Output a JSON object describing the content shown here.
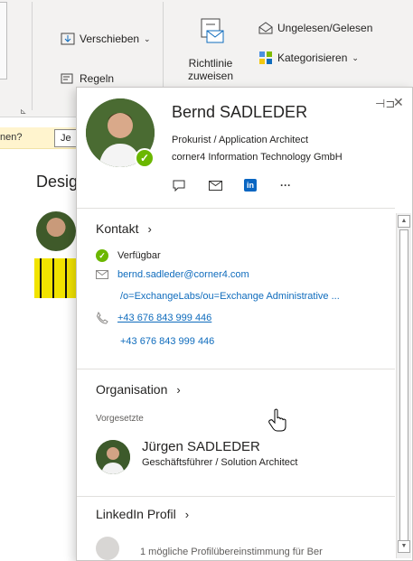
{
  "ribbon": {
    "move_label": "Verschieben",
    "rules_label": "Regeln",
    "policy_label": "Richtlinie",
    "policy_label_line2": "zuweisen",
    "unread_label": "Ungelesen/Gelesen",
    "categorize_label": "Kategorisieren"
  },
  "infobar": {
    "text": "nen?",
    "button_label": "Je"
  },
  "background": {
    "subject": "Desig"
  },
  "card": {
    "name": "Bernd SADLEDER",
    "title": "Prokurist / Application Architect",
    "company": "corner4 Information Technology GmbH",
    "contact_section": {
      "heading": "Kontakt",
      "status": "Verfügbar",
      "email": "bernd.sadleder@corner4.com",
      "exchange_address": "/o=ExchangeLabs/ou=Exchange Administrative ...",
      "phone_1": "+43 676 843 999 446",
      "phone_2": "+43 676 843 999 446"
    },
    "organisation_section": {
      "heading": "Organisation",
      "manager_label": "Vorgesetzte",
      "manager_name": "Jürgen SADLEDER",
      "manager_title": "Geschäftsführer / Solution Architect"
    },
    "linkedin_section": {
      "heading": "LinkedIn Profil",
      "match_text": "1 mögliche Profilübereinstimmung für Ber"
    }
  },
  "colors": {
    "presence_green": "#6bb700",
    "link_blue": "#0f6cbd",
    "linkedin_blue": "#0a66c2",
    "infobar_yellow": "#fff4ce"
  }
}
